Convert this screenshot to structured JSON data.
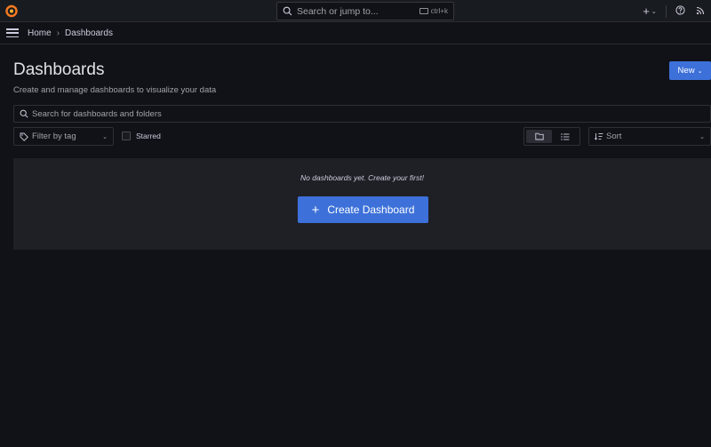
{
  "topbar": {
    "search_placeholder": "Search or jump to...",
    "shortcut": "ctrl+k",
    "add_icon": "+"
  },
  "breadcrumb": {
    "home": "Home",
    "separator": "›",
    "current": "Dashboards"
  },
  "page": {
    "title": "Dashboards",
    "subtitle": "Create and manage dashboards to visualize your data",
    "new_button": "New"
  },
  "filters": {
    "search_placeholder": "Search for dashboards and folders",
    "tag_placeholder": "Filter by tag",
    "starred_label": "Starred",
    "sort_placeholder": "Sort"
  },
  "empty_state": {
    "message": "No dashboards yet. Create your first!",
    "create_button": "Create Dashboard",
    "create_icon": "+"
  },
  "colors": {
    "accent": "#3d71d9",
    "background": "#111217",
    "panel": "#1f2026",
    "logo": "#f47a20"
  }
}
